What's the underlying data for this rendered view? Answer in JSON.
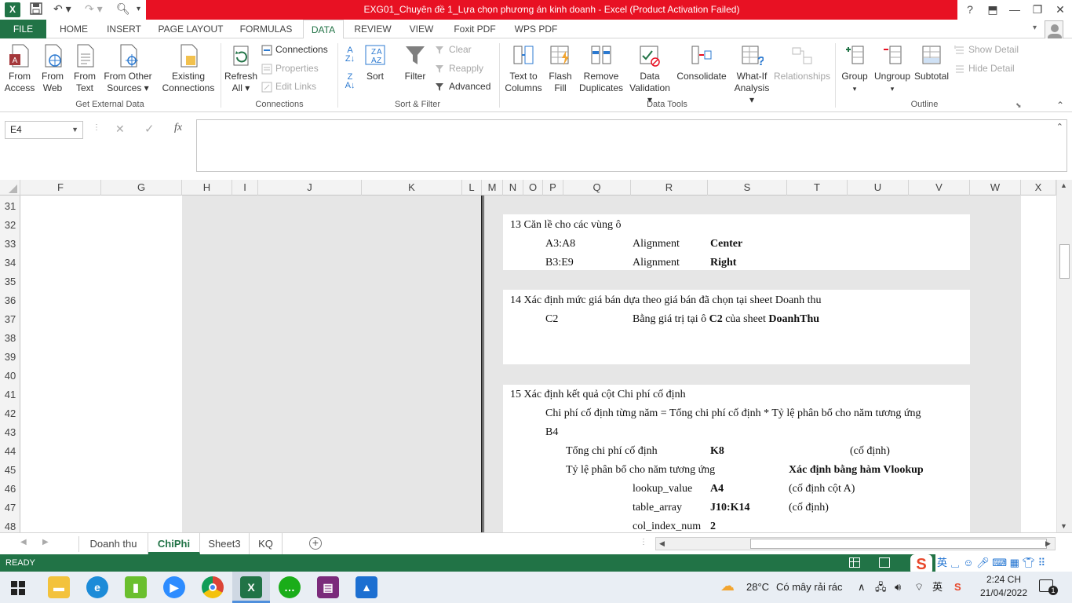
{
  "window": {
    "title": "EXG01_Chuyên đề 1_Lựa chọn phương án kinh doanh -  Excel (Product Activation Failed)",
    "help": "?",
    "app_icon": "X"
  },
  "tabs": [
    "FILE",
    "HOME",
    "INSERT",
    "PAGE LAYOUT",
    "FORMULAS",
    "DATA",
    "REVIEW",
    "VIEW",
    "Foxit PDF",
    "WPS PDF"
  ],
  "active_tab": "DATA",
  "ribbon": {
    "get_external": {
      "group_label": "Get External Data",
      "from_access": "From Access",
      "from_web": "From Web",
      "from_text": "From Text",
      "from_other": "From Other Sources ▾",
      "existing": "Existing Connections"
    },
    "connections": {
      "group_label": "Connections",
      "refresh_all": "Refresh All ▾",
      "connections": "Connections",
      "properties": "Properties",
      "edit_links": "Edit Links"
    },
    "sort_filter": {
      "group_label": "Sort & Filter",
      "sort": "Sort",
      "filter": "Filter",
      "clear": "Clear",
      "reapply": "Reapply",
      "advanced": "Advanced"
    },
    "data_tools": {
      "group_label": "Data Tools",
      "text_to_columns": "Text to Columns",
      "flash_fill": "Flash Fill",
      "remove_duplicates": "Remove Duplicates",
      "data_validation": "Data Validation ▾",
      "consolidate": "Consolidate",
      "what_if": "What-If Analysis ▾",
      "relationships": "Relationships"
    },
    "outline": {
      "group_label": "Outline",
      "group": "Group",
      "ungroup": "Ungroup",
      "subtotal": "Subtotal",
      "show_detail": "Show Detail",
      "hide_detail": "Hide Detail"
    }
  },
  "formula_bar": {
    "name_box": "E4",
    "fx": "fx",
    "content": ""
  },
  "columns": [
    "F",
    "G",
    "H",
    "I",
    "J",
    "K",
    "L",
    "M",
    "N",
    "O",
    "P",
    "Q",
    "R",
    "S",
    "T",
    "U",
    "V",
    "W",
    "X"
  ],
  "rows": [
    "31",
    "32",
    "33",
    "34",
    "35",
    "36",
    "37",
    "38",
    "39",
    "40",
    "41",
    "42",
    "43",
    "44",
    "45",
    "46",
    "47",
    "48"
  ],
  "cells": {
    "r32": "13 Căn lề cho các vùng ô",
    "r33a": "A3:A8",
    "r33b": "Alignment",
    "r33c": "Center",
    "r34a": "B3:E9",
    "r34b": "Alignment",
    "r34c": "Right",
    "r36": "14 Xác định mức giá bán dựa theo giá bán đã chọn tại sheet Doanh thu",
    "r37a": "C2",
    "r37b": "Bằng giá trị tại ô",
    "r37c": "C2",
    "r37d": "của sheet",
    "r37e": "DoanhThu",
    "r41": "15 Xác định kết quả cột Chi phí cố định",
    "r42": "Chi phí cố định từng năm = Tổng chi phí cố định * Tỷ lệ phân bổ cho năm tương ứng",
    "r43": "B4",
    "r44a": "Tổng chi phí cố định",
    "r44b": "K8",
    "r44c": "(cố định)",
    "r45a": "Tỷ lệ phân bổ cho năm tương ứng",
    "r45b": "Xác định bằng hàm Vlookup",
    "r46a": "lookup_value",
    "r46b": "A4",
    "r46c": "(cố định cột A)",
    "r47a": "table_array",
    "r47b": "J10:K14",
    "r47c": "(cố định)",
    "r48a": "col_index_num",
    "r48b": "2"
  },
  "sheets": [
    "Doanh thu",
    "ChiPhi",
    "Sheet3",
    "KQ"
  ],
  "active_sheet": "ChiPhi",
  "status": "READY",
  "taskbar": {
    "weather_temp": "28°C",
    "weather_text": "Có mây rải rác",
    "time": "2:24 CH",
    "date": "21/04/2022",
    "ime": "英",
    "notif": "1"
  },
  "colors": {
    "excel_green": "#217346",
    "title_red": "#e81123",
    "gray_fill": "#e6e6e6"
  }
}
